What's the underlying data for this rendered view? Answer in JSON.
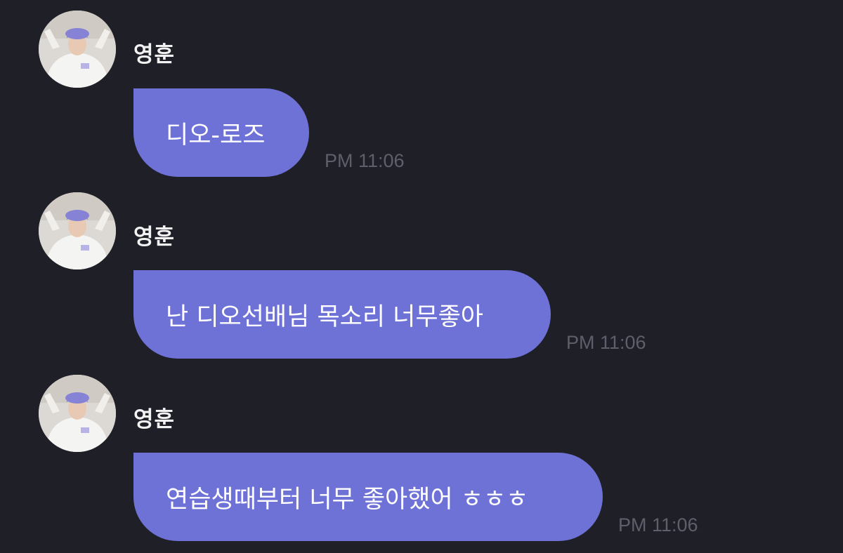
{
  "messages": [
    {
      "sender": "영훈",
      "text": "디오-로즈",
      "time": "PM 11:06"
    },
    {
      "sender": "영훈",
      "text": "난 디오선배님 목소리 너무좋아",
      "time": "PM 11:06"
    },
    {
      "sender": "영훈",
      "text": "연습생때부터 너무 좋아했어 ㅎㅎㅎ",
      "time": "PM 11:06"
    }
  ],
  "colors": {
    "background": "#1f1f28",
    "bubble": "#6e72d6",
    "timestamp": "#5f5f6b"
  },
  "icons": {
    "avatar": "profile-photo"
  }
}
